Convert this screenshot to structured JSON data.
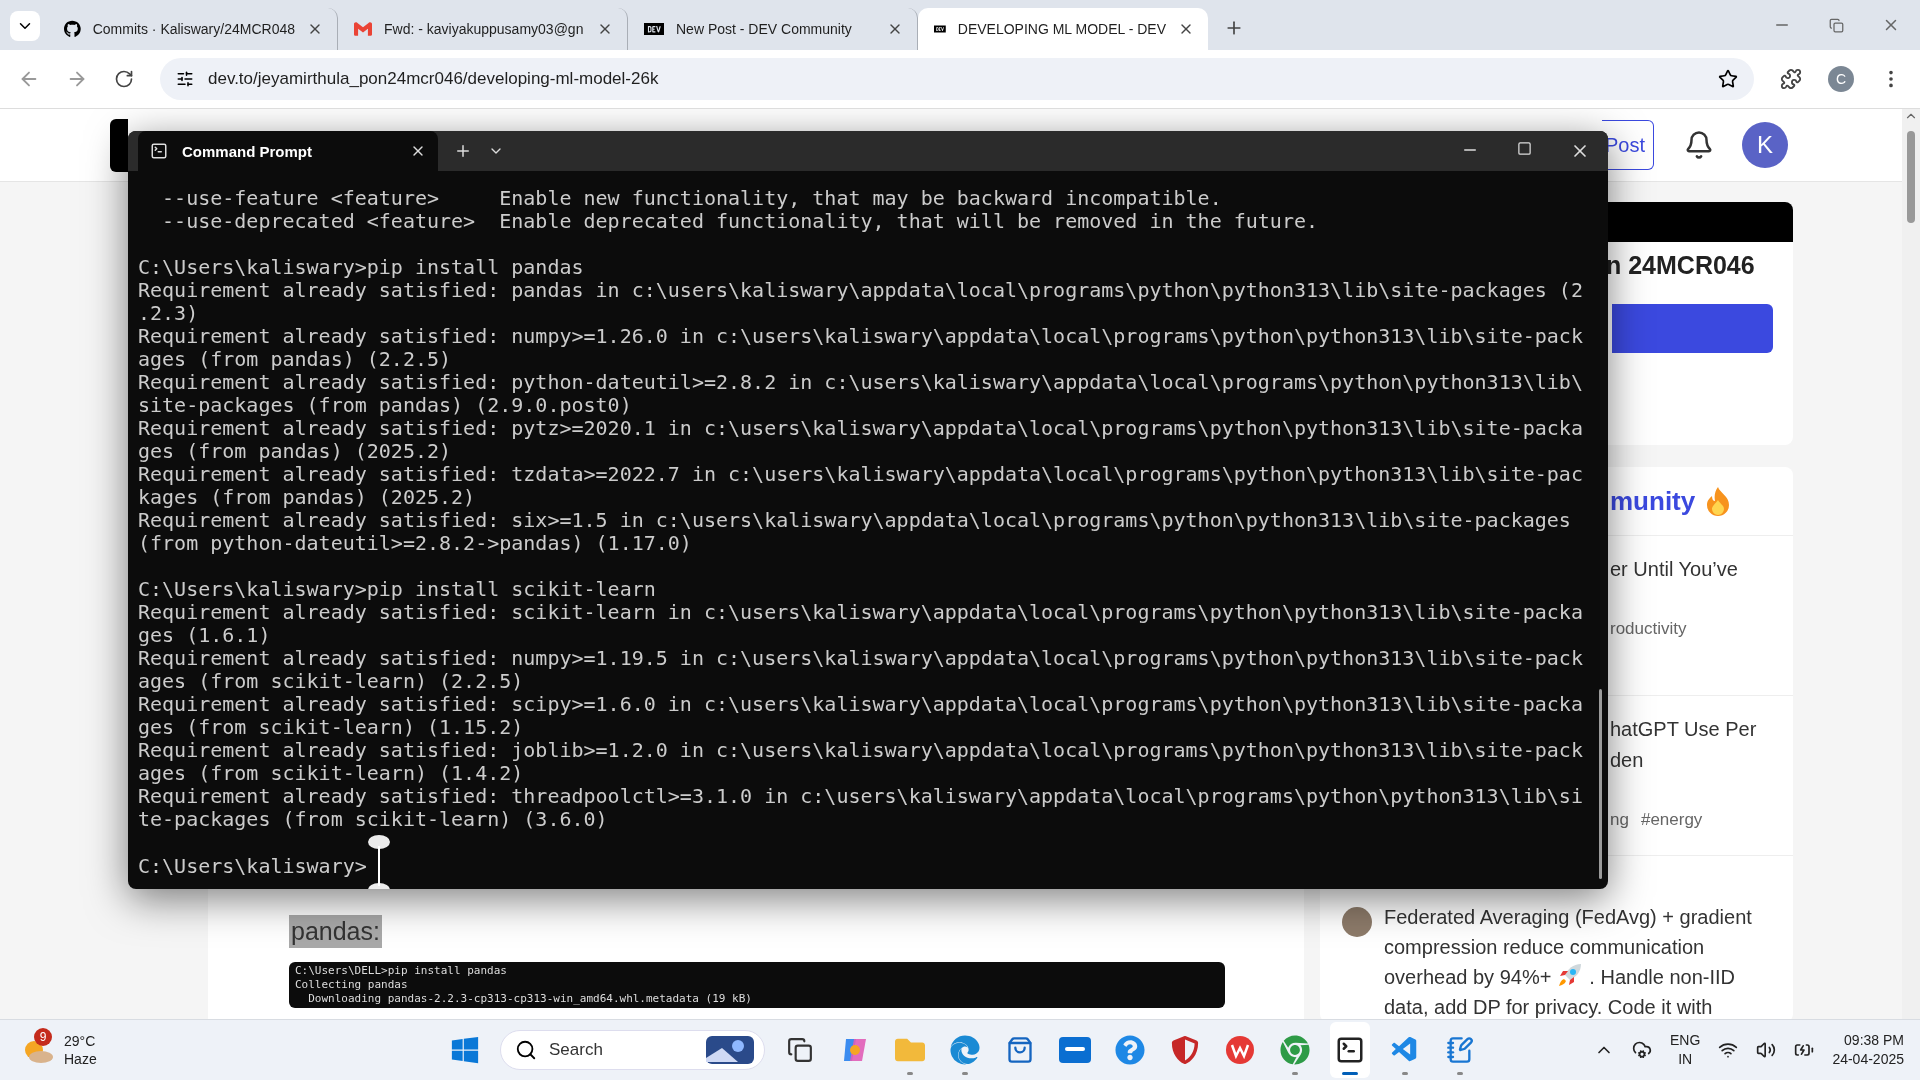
{
  "browser": {
    "tabs": [
      {
        "title": "Commits · Kaliswary/24MCR048",
        "selected": false
      },
      {
        "title": "Fwd: - kaviyakuppusamy03@gn",
        "selected": false
      },
      {
        "title": "New Post - DEV Community",
        "selected": false
      },
      {
        "title": "DEVELOPING ML MODEL - DEV",
        "selected": true
      }
    ],
    "url": "dev.to/jeyamirthula_pon24mcr046/developing-ml-model-26k",
    "profile": "C"
  },
  "page": {
    "header": {
      "post_button": "Post",
      "avatar": "K"
    },
    "article": {
      "highlight": "pandas:",
      "code_lines": [
        "C:\\Users\\DELL>pip install pandas",
        "Collecting pandas",
        "  Downloading pandas-2.2.3-cp313-cp313-win_amd64.whl.metadata (19 kB)"
      ]
    },
    "sidebar": {
      "profile_name": "n 24MCR046",
      "discussion_heading": "munity",
      "posts": [
        {
          "title": [
            "er Until You’ve"
          ],
          "tags": [
            "roductivity"
          ]
        },
        {
          "title": [
            "hatGPT Use Per",
            "den"
          ],
          "tags": [
            "ng",
            "#energy"
          ]
        }
      ],
      "comment": [
        [
          "Federated Averaging (FedAvg) + gradient"
        ],
        [
          "compression reduce communication"
        ],
        [
          "overhead by 94%+",
          ". Handle non-IID"
        ],
        [
          "data, add DP for privacy. Code it with"
        ]
      ]
    }
  },
  "terminal": {
    "title": "Command Prompt",
    "blocks": [
      [
        "  --use-feature <feature>     Enable new functionality, that may be backward incompatible.",
        "  --use-deprecated <feature>  Enable deprecated functionality, that will be removed in the future."
      ],
      [
        "C:\\Users\\kaliswary>pip install pandas",
        "Requirement already satisfied: pandas in c:\\users\\kaliswary\\appdata\\local\\programs\\python\\python313\\lib\\site-packages (2",
        ".2.3)",
        "Requirement already satisfied: numpy>=1.26.0 in c:\\users\\kaliswary\\appdata\\local\\programs\\python\\python313\\lib\\site-pack",
        "ages (from pandas) (2.2.5)",
        "Requirement already satisfied: python-dateutil>=2.8.2 in c:\\users\\kaliswary\\appdata\\local\\programs\\python\\python313\\lib\\",
        "site-packages (from pandas) (2.9.0.post0)",
        "Requirement already satisfied: pytz>=2020.1 in c:\\users\\kaliswary\\appdata\\local\\programs\\python\\python313\\lib\\site-packa",
        "ges (from pandas) (2025.2)",
        "Requirement already satisfied: tzdata>=2022.7 in c:\\users\\kaliswary\\appdata\\local\\programs\\python\\python313\\lib\\site-pac",
        "kages (from pandas) (2025.2)",
        "Requirement already satisfied: six>=1.5 in c:\\users\\kaliswary\\appdata\\local\\programs\\python\\python313\\lib\\site-packages",
        "(from python-dateutil>=2.8.2->pandas) (1.17.0)"
      ],
      [
        "C:\\Users\\kaliswary>pip install scikit-learn",
        "Requirement already satisfied: scikit-learn in c:\\users\\kaliswary\\appdata\\local\\programs\\python\\python313\\lib\\site-packa",
        "ges (1.6.1)",
        "Requirement already satisfied: numpy>=1.19.5 in c:\\users\\kaliswary\\appdata\\local\\programs\\python\\python313\\lib\\site-pack",
        "ages (from scikit-learn) (2.2.5)",
        "Requirement already satisfied: scipy>=1.6.0 in c:\\users\\kaliswary\\appdata\\local\\programs\\python\\python313\\lib\\site-packa",
        "ges (from scikit-learn) (1.15.2)",
        "Requirement already satisfied: joblib>=1.2.0 in c:\\users\\kaliswary\\appdata\\local\\programs\\python\\python313\\lib\\site-pack",
        "ages (from scikit-learn) (1.4.2)",
        "Requirement already satisfied: threadpoolctl>=3.1.0 in c:\\users\\kaliswary\\appdata\\local\\programs\\python\\python313\\lib\\si",
        "te-packages (from scikit-learn) (3.6.0)"
      ],
      [
        "C:\\Users\\kaliswary>"
      ]
    ]
  },
  "taskbar": {
    "weather": {
      "badge": "9",
      "temperature": "29°C",
      "condition": "Haze"
    },
    "search": {
      "placeholder": "Search"
    },
    "apps": [
      {
        "running": false,
        "selected": false
      },
      {
        "running": false,
        "selected": false
      },
      {
        "running": false,
        "selected": false
      },
      {
        "running": true,
        "selected": false
      },
      {
        "running": true,
        "selected": false
      },
      {
        "running": false,
        "selected": false
      },
      {
        "running": false,
        "selected": false
      },
      {
        "running": false,
        "selected": false
      },
      {
        "running": false,
        "selected": false
      },
      {
        "running": false,
        "selected": false
      },
      {
        "running": true,
        "selected": false
      },
      {
        "running": true,
        "selected": true
      },
      {
        "running": true,
        "selected": false
      },
      {
        "running": true,
        "selected": false
      }
    ],
    "language": [
      "ENG",
      "IN"
    ],
    "time": "09:38 PM",
    "date": "24-04-2025"
  }
}
